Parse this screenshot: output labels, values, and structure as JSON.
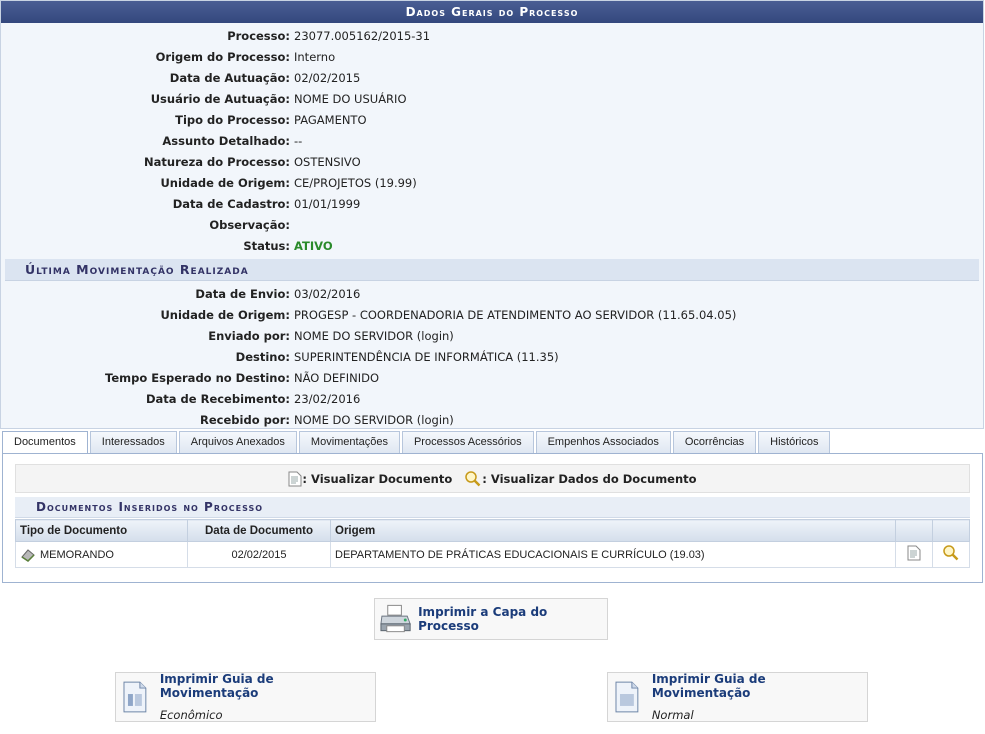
{
  "panel": {
    "title": "Dados Gerais do Processo",
    "fields": [
      {
        "label": "Processo:",
        "value": "23077.005162/2015-31"
      },
      {
        "label": "Origem do Processo:",
        "value": "Interno"
      },
      {
        "label": "Data de Autuação:",
        "value": "02/02/2015"
      },
      {
        "label": "Usuário de Autuação:",
        "value": "NOME DO USUÁRIO"
      },
      {
        "label": "Tipo do Processo:",
        "value": "PAGAMENTO"
      },
      {
        "label": "Assunto Detalhado:",
        "value": "--"
      },
      {
        "label": "Natureza do Processo:",
        "value": "OSTENSIVO"
      },
      {
        "label": "Unidade de Origem:",
        "value": "CE/PROJETOS (19.99)"
      },
      {
        "label": "Data de Cadastro:",
        "value": "01/01/1999"
      },
      {
        "label": "Observação:",
        "value": ""
      },
      {
        "label": "Status:",
        "value": "ATIVO"
      }
    ],
    "last_move": {
      "title": "Última Movimentação Realizada",
      "fields": [
        {
          "label": "Data de Envio:",
          "value": "03/02/2016"
        },
        {
          "label": "Unidade de Origem:",
          "value": "PROGESP - COORDENADORIA DE ATENDIMENTO AO SERVIDOR (11.65.04.05)"
        },
        {
          "label": "Enviado por:",
          "value": "NOME DO SERVIDOR (login)"
        },
        {
          "label": "Destino:",
          "value": "SUPERINTENDÊNCIA DE INFORMÁTICA (11.35)"
        },
        {
          "label": "Tempo Esperado no Destino:",
          "value": "NÃO DEFINIDO"
        },
        {
          "label": "Data de Recebimento:",
          "value": "23/02/2016"
        },
        {
          "label": "Recebido por:",
          "value": "NOME DO SERVIDOR (login)"
        }
      ]
    }
  },
  "tabs": [
    "Documentos",
    "Interessados",
    "Arquivos Anexados",
    "Movimentações",
    "Processos Acessórios",
    "Empenhos Associados",
    "Ocorrências",
    "Históricos"
  ],
  "legend": {
    "view_doc": ": Visualizar Documento",
    "view_data": ": Visualizar Dados do Documento"
  },
  "documents": {
    "title": "Documentos Inseridos no Processo",
    "headers": [
      "Tipo de Documento",
      "Data de Documento",
      "Origem"
    ],
    "rows": [
      {
        "tipo": "MEMORANDO",
        "data": "02/02/2015",
        "origem": "DEPARTAMENTO DE PRÁTICAS EDUCACIONAIS E CURRÍCULO (19.03)"
      }
    ]
  },
  "buttons": {
    "print_cover": "Imprimir a Capa do Processo",
    "guide_eco": {
      "label": "Imprimir Guia de Movimentação",
      "sub": "Econômico"
    },
    "guide_normal": {
      "label": "Imprimir Guia de Movimentação",
      "sub": "Normal"
    }
  },
  "colors": {
    "header": "#3d5289",
    "status": "#2a8a2a",
    "link": "#1b3c7a"
  }
}
